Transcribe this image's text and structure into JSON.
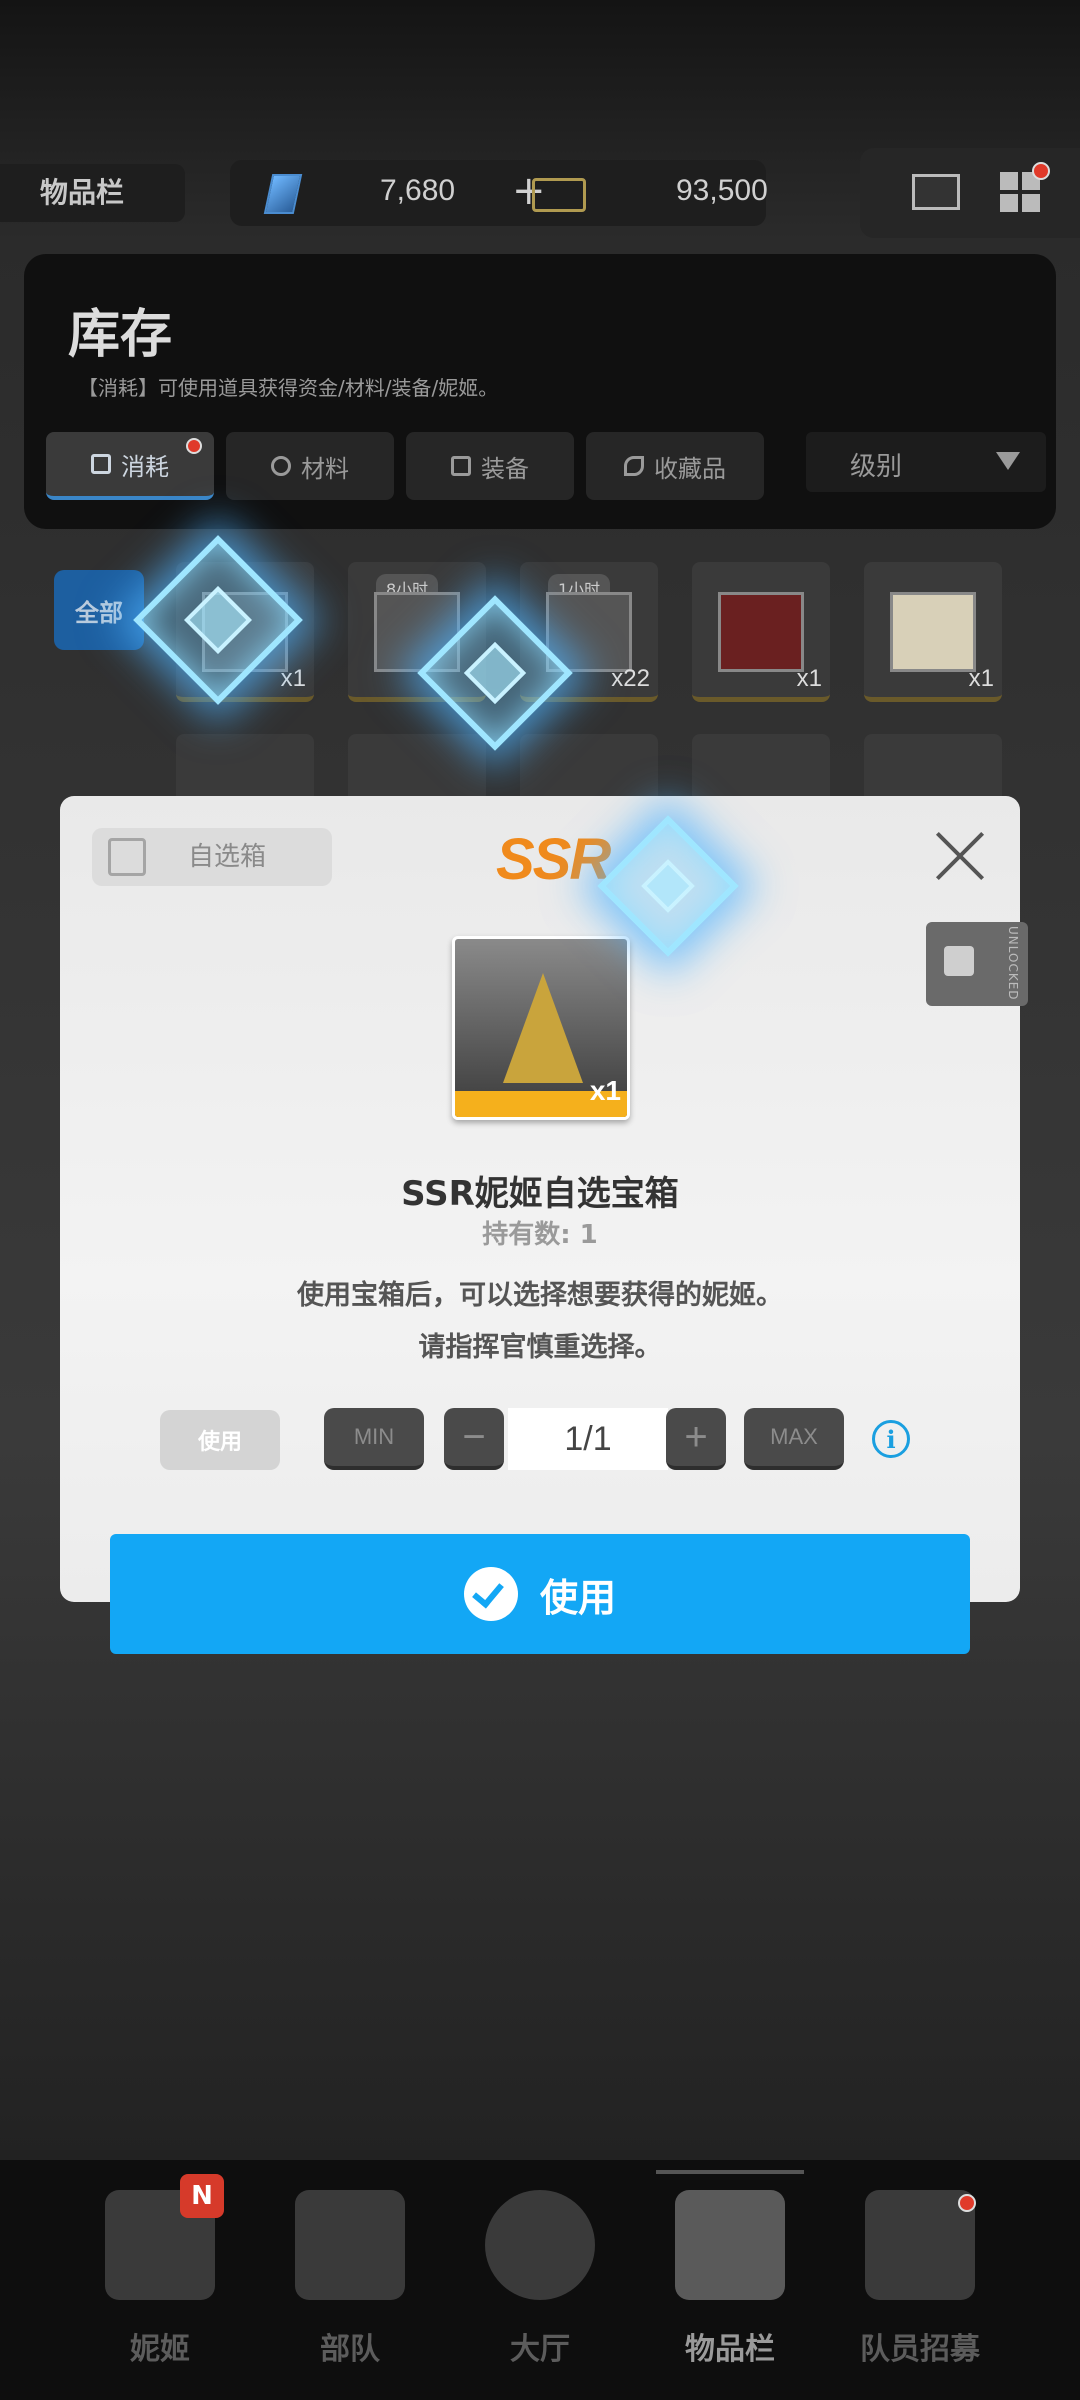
{
  "topbar": {
    "section_label": "物品栏",
    "gems": "7,680",
    "gems_plus": "+",
    "credits": "93,500"
  },
  "inventory": {
    "title": "库存",
    "subtitle": "【消耗】可使用道具获得资金/材料/装备/妮姬。",
    "tabs": [
      "消耗",
      "材料",
      "装备",
      "收藏品"
    ],
    "active_tab": "消耗",
    "sort_label": "级别",
    "all_filter": "全部"
  },
  "grid_items": [
    {
      "tag": "",
      "count": "x1"
    },
    {
      "tag": "8小时",
      "count": ""
    },
    {
      "tag": "1小时",
      "count": "x22"
    },
    {
      "tag": "",
      "count": "x1"
    },
    {
      "tag": "",
      "count": "x1"
    }
  ],
  "modal": {
    "category": "自选箱",
    "rarity": "SSR",
    "item_count": "x1",
    "item_name": "SSR妮姬自选宝箱",
    "owned": "持有数: 1",
    "description_line1": "使用宝箱后，可以选择想要获得的妮姬。",
    "description_line2": "请指挥官慎重选择。",
    "use_small_label": "使用",
    "min_label": "MIN",
    "max_label": "MAX",
    "quantity": "1/1",
    "use_button_label": "使用"
  },
  "side_tab": {
    "label": "UNLOCKED"
  },
  "nav": {
    "items": [
      "妮姬",
      "部队",
      "大厅",
      "物品栏",
      "队员招募"
    ],
    "active": "物品栏",
    "badge": "N"
  },
  "colors": {
    "accent_blue": "#13a7f5",
    "ssr_orange": "#f08a1c",
    "badge_red": "#d63a2a"
  }
}
